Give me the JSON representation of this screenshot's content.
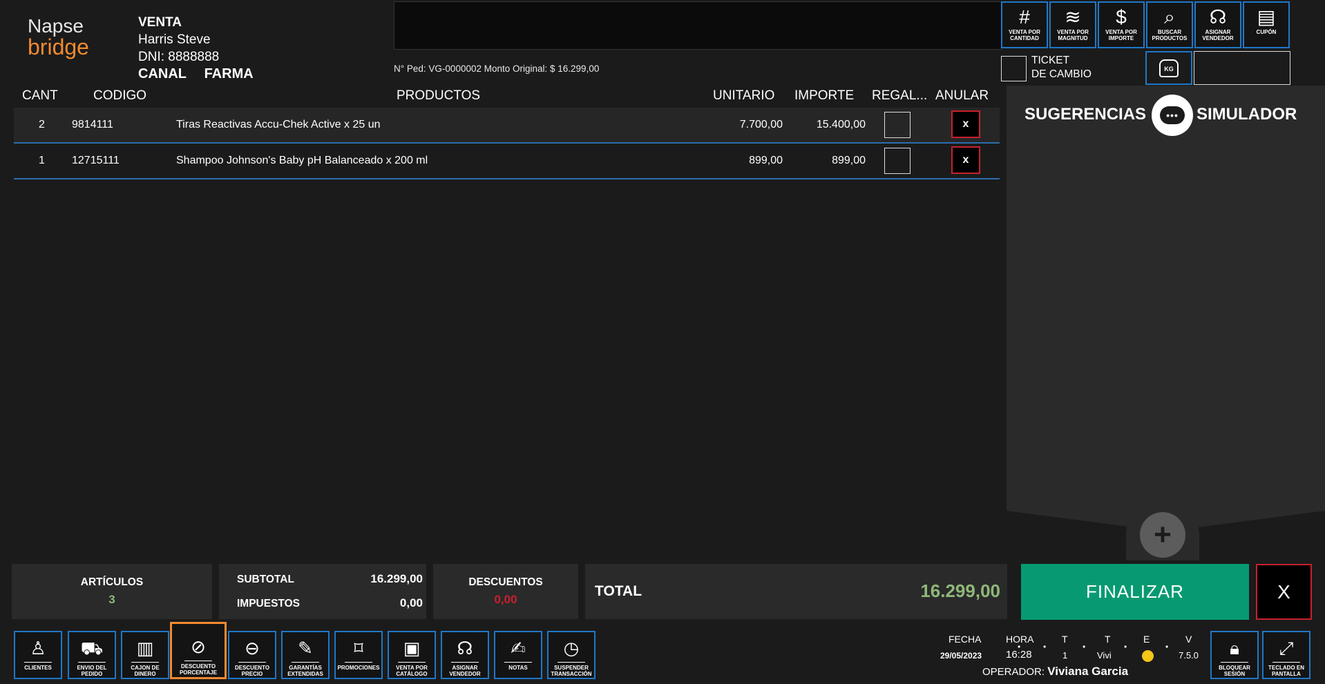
{
  "logo": {
    "top": "Napse",
    "bottom": "bridge"
  },
  "customer": {
    "type": "VENTA",
    "name": "Harris Steve",
    "dni": "DNI: 8888888",
    "channel_label": "CANAL",
    "channel_value": "FARMA"
  },
  "order": {
    "info": "N° Ped: VG-0000002  Monto Original: $ 16.299,00"
  },
  "tools": [
    {
      "icon": "#",
      "label": "VENTA POR\nCANTIDAD"
    },
    {
      "icon": "≋",
      "label": "VENTA POR\nMAGNITUD"
    },
    {
      "icon": "$",
      "label": "VENTA POR\nIMPORTE"
    },
    {
      "icon": "⌕",
      "label": "BUSCAR\nPRODUCTOS"
    },
    {
      "icon": "☊",
      "label": "ASIGNAR\nVENDEDOR"
    },
    {
      "icon": "▤",
      "label": "CUPÓN"
    }
  ],
  "ticket": {
    "label": "TICKET\nDE CAMBIO"
  },
  "kg": {
    "label": "KG"
  },
  "table": {
    "headers": {
      "cant": "CANT",
      "codigo": "CODIGO",
      "productos": "PRODUCTOS",
      "unitario": "UNITARIO",
      "importe": "IMPORTE",
      "regalo": "REGAL...",
      "anular": "ANULAR"
    },
    "rows": [
      {
        "cant": "2",
        "codigo": "9814111",
        "producto": "Tiras Reactivas Accu-Chek Active x 25 un",
        "unitario": "7.700,00",
        "importe": "15.400,00",
        "anular": "x"
      },
      {
        "cant": "1",
        "codigo": "12715111",
        "producto": "Shampoo Johnson's Baby pH Balanceado x 200 ml",
        "unitario": "899,00",
        "importe": "899,00",
        "anular": "x"
      }
    ]
  },
  "side": {
    "sugerencias": "SUGERENCIAS",
    "simulador": "SIMULADOR",
    "chat": "•••",
    "plus": "+"
  },
  "totals": {
    "articulos_label": "ARTÍCULOS",
    "articulos_value": "3",
    "subtotal_label": "SUBTOTAL",
    "subtotal_value": "16.299,00",
    "impuestos_label": "IMPUESTOS",
    "impuestos_value": "0,00",
    "descuentos_label": "DESCUENTOS",
    "descuentos_value": "0,00",
    "total_label": "TOTAL",
    "total_value": "16.299,00",
    "finalizar": "FINALIZAR",
    "cancel": "X"
  },
  "bottom": [
    {
      "icon": "♙",
      "label": "CLIENTES"
    },
    {
      "icon": "⛟",
      "label": "ENVIO DEL\nPEDIDO"
    },
    {
      "icon": "▥",
      "label": "CAJON DE\nDINERO"
    },
    {
      "icon": "⊘",
      "label": "DESCUENTO\nPORCENTAJE"
    },
    {
      "icon": "⊖",
      "label": "DESCUENTO\nPRECIO"
    },
    {
      "icon": "✎",
      "label": "GARANTÍAS\nEXTENDIDAS"
    },
    {
      "icon": "⌑",
      "label": "PROMOCIONES"
    },
    {
      "icon": "▣",
      "label": "VENTA POR\nCATÁLOGO"
    },
    {
      "icon": "☊",
      "label": "ASIGNAR\nVENDEDOR"
    },
    {
      "icon": "✍",
      "label": "NOTAS"
    },
    {
      "icon": "◷",
      "label": "SUSPENDER\nTRANSACCIÓN"
    }
  ],
  "status": {
    "fecha_label": "FECHA",
    "fecha_value": "29/05/2023",
    "hora_label": "HORA",
    "hora_value": "16:28",
    "t1_label": "T",
    "t1_value": "1",
    "t2_label": "T",
    "t2_value": "Vivi",
    "e_label": "E",
    "v_label": "V",
    "v_value": "7.5.0",
    "operador_label": "OPERADOR:",
    "operador_value": "Viviana Garcia"
  },
  "right_buttons": [
    {
      "icon": "🔒︎",
      "label": "BLOQUEAR\nSESIÓN"
    },
    {
      "icon": "⤢",
      "label": "TECLADO EN\nPANTALLA"
    }
  ]
}
